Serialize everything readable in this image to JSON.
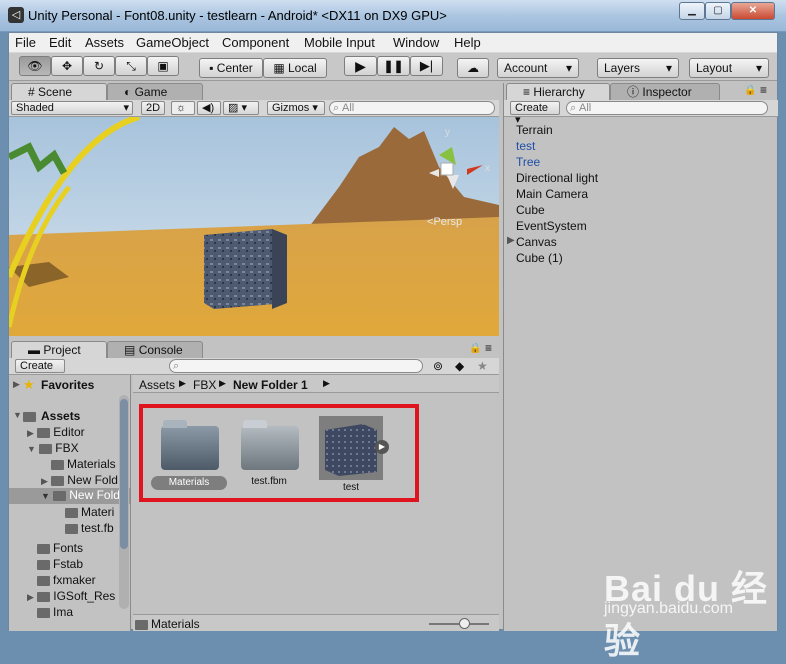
{
  "window": {
    "title": "Unity Personal - Font08.unity - testlearn - Android* <DX11 on DX9 GPU>",
    "icon": "unity-icon"
  },
  "menu": [
    "File",
    "Edit",
    "Assets",
    "GameObject",
    "Component",
    "Mobile Input",
    "Window",
    "Help"
  ],
  "toolbar": {
    "center": "Center",
    "local": "Local",
    "account": "Account",
    "layers": "Layers",
    "layout": "Layout"
  },
  "scene": {
    "tab_scene": "Scene",
    "tab_game": "Game",
    "shaded": "Shaded",
    "mode_2d": "2D",
    "gizmos": "Gizmos",
    "search_placeholder": "All",
    "persp": "Persp",
    "axis_y": "y",
    "axis_x": "x"
  },
  "hierarchy": {
    "tab": "Hierarchy",
    "inspector_tab": "Inspector",
    "create": "Create",
    "search_placeholder": "All",
    "items": [
      "Terrain",
      "test",
      "Tree",
      "Directional light",
      "Main Camera",
      "Cube",
      "EventSystem",
      "Canvas",
      "Cube (1)"
    ]
  },
  "project": {
    "tab": "Project",
    "console_tab": "Console",
    "create": "Create",
    "favorites": "Favorites",
    "assets": "Assets",
    "tree": [
      "Editor",
      "FBX",
      "Materials",
      "New Fold",
      "New Fold",
      "Materi",
      "test.fb",
      "Fonts",
      "Fstab",
      "fxmaker",
      "IGSoft_Res",
      "Ima"
    ],
    "breadcrumb": [
      "Assets",
      "FBX",
      "New Folder 1"
    ],
    "grid": [
      "Materials",
      "test.fbm",
      "test"
    ],
    "status": "Materials"
  },
  "watermark": {
    "logo": "Bai du 经验",
    "url": "jingyan.baidu.com"
  }
}
